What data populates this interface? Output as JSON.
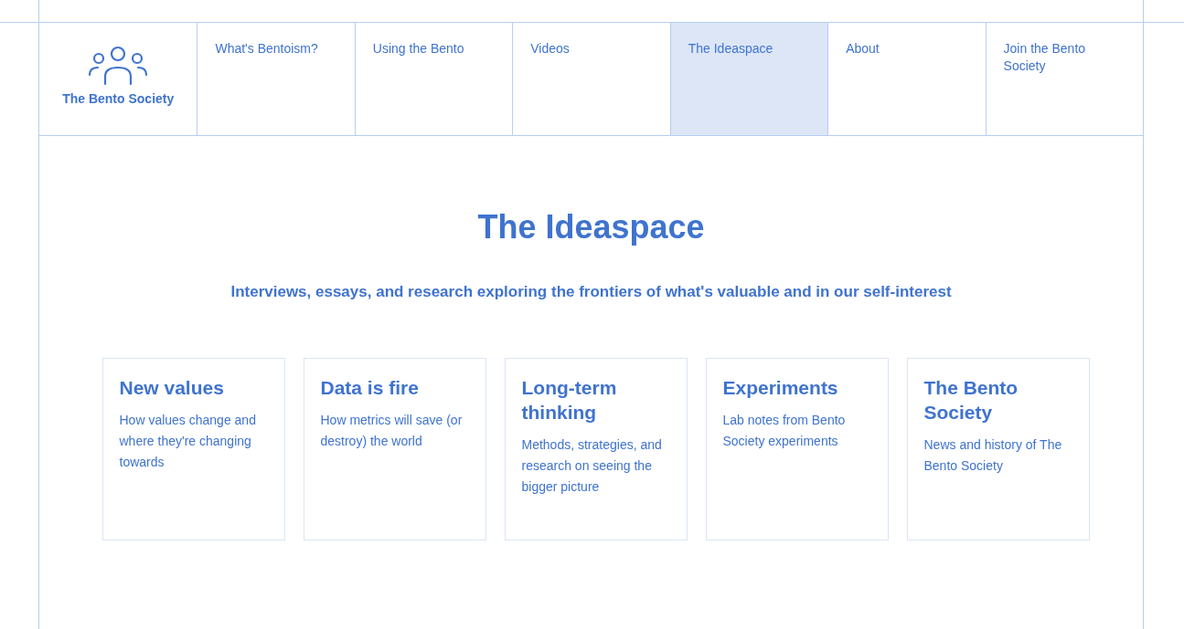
{
  "logo": {
    "name": "The Bento Society"
  },
  "nav": [
    {
      "label": "What's Bentoism?",
      "selected": false
    },
    {
      "label": "Using the Bento",
      "selected": false
    },
    {
      "label": "Videos",
      "selected": false
    },
    {
      "label": "The Ideaspace",
      "selected": true
    },
    {
      "label": "About",
      "selected": false
    },
    {
      "label": "Join the Bento Society",
      "selected": false
    }
  ],
  "hero": {
    "title": "The Ideaspace",
    "subtitle": "Interviews, essays, and research exploring the frontiers of what's valuable and in our self-interest"
  },
  "cards": [
    {
      "title": "New values",
      "description": "How values change and where they're changing towards"
    },
    {
      "title": "Data is fire",
      "description": "How metrics will save (or destroy) the world"
    },
    {
      "title": "Long-term thinking",
      "description": "Methods, strategies, and research on seeing the bigger picture"
    },
    {
      "title": "Experiments",
      "description": "Lab notes from Bento Society experiments"
    },
    {
      "title": "The Bento Society",
      "description": "News and history of The Bento Society"
    }
  ]
}
